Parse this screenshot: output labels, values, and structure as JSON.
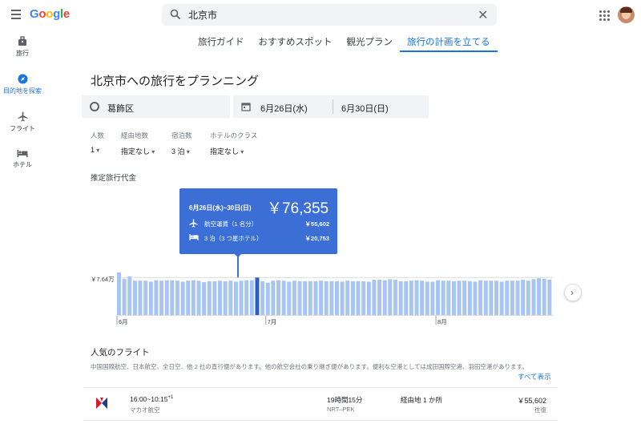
{
  "header": {
    "logo": "Google",
    "search_value": "北京市"
  },
  "tabs": [
    {
      "label": "旅行ガイド",
      "active": false
    },
    {
      "label": "おすすめスポット",
      "active": false
    },
    {
      "label": "観光プラン",
      "active": false
    },
    {
      "label": "旅行の計画を立てる",
      "active": true
    }
  ],
  "sidebar": {
    "items": [
      {
        "label": "旅行",
        "icon": "suitcase-icon",
        "active": false
      },
      {
        "label": "目的地を探索",
        "icon": "compass-icon",
        "active": true
      },
      {
        "label": "フライト",
        "icon": "airplane-icon",
        "active": false
      },
      {
        "label": "ホテル",
        "icon": "bed-icon",
        "active": false
      }
    ]
  },
  "main": {
    "heading": "北京市への旅行をプランニング",
    "origin": "葛飾区",
    "depart_date": "6月26日(水)",
    "return_date": "6月30日(日)",
    "filters": [
      {
        "label": "人数",
        "value": "1"
      },
      {
        "label": "経由地数",
        "value": "指定なし"
      },
      {
        "label": "宿泊数",
        "value": "3 泊"
      },
      {
        "label": "ホテルのクラス",
        "value": "指定なし"
      }
    ],
    "estimate_label": "推定旅行代金"
  },
  "tooltip": {
    "range": "6月26日(水)~30日(日)",
    "total": "￥76,355",
    "flight_label": "航空運賃（1 名分）",
    "flight_price": "￥55,602",
    "hotel_label": "3 泊（3 つ星ホテル）",
    "hotel_price": "￥20,753"
  },
  "chart_data": {
    "type": "bar",
    "title": "推定旅行代金",
    "ylabel_marker": "￥7.64万",
    "reference_value": 7.64,
    "month_labels": [
      "6月",
      "7月",
      "8月"
    ],
    "selected_index": 26,
    "values": [
      8.7,
      7.4,
      7.9,
      7.0,
      7.0,
      7.0,
      6.8,
      7.1,
      7.0,
      7.1,
      7.1,
      7.0,
      6.8,
      7.0,
      7.1,
      7.0,
      6.7,
      6.9,
      6.9,
      7.0,
      6.9,
      7.0,
      6.8,
      7.0,
      7.1,
      7.1,
      7.64,
      6.9,
      6.6,
      7.0,
      7.1,
      7.0,
      6.8,
      7.0,
      6.9,
      6.9,
      6.9,
      6.9,
      7.0,
      6.9,
      6.9,
      6.9,
      6.8,
      7.0,
      6.9,
      6.9,
      6.9,
      6.8,
      7.2,
      7.2,
      7.1,
      7.3,
      7.2,
      6.9,
      6.9,
      7.0,
      7.1,
      7.0,
      6.8,
      6.8,
      7.1,
      7.0,
      7.0,
      6.9,
      7.0,
      7.0,
      6.9,
      6.8,
      7.1,
      7.0,
      7.0,
      7.0,
      6.8,
      7.0,
      7.0,
      7.0,
      7.2,
      7.0,
      7.3,
      7.5,
      7.4,
      7.2
    ],
    "ylim": [
      0,
      9
    ]
  },
  "popular": {
    "title": "人気のフライト",
    "description": "中国国際航空、日本航空、全日空、他 2 社の直行便があります。他の航空会社の乗り継ぎ便があります。便利な空港としては成田国際空港、羽田空港があります。",
    "show_all": "すべて表示"
  },
  "flight": {
    "time": "16:00~10:15",
    "day_offset": "+1",
    "airline": "マカオ航空",
    "duration": "19時間15分",
    "route": "NRT–PEK",
    "stops": "経由地 1 か所",
    "price": "￥55,602",
    "price_type": "往復"
  },
  "colors": {
    "accent": "#1a73e8",
    "bar": "#a8c4f0",
    "bar_selected": "#2f5fc4",
    "tooltip_bg": "#3b6fd6"
  }
}
